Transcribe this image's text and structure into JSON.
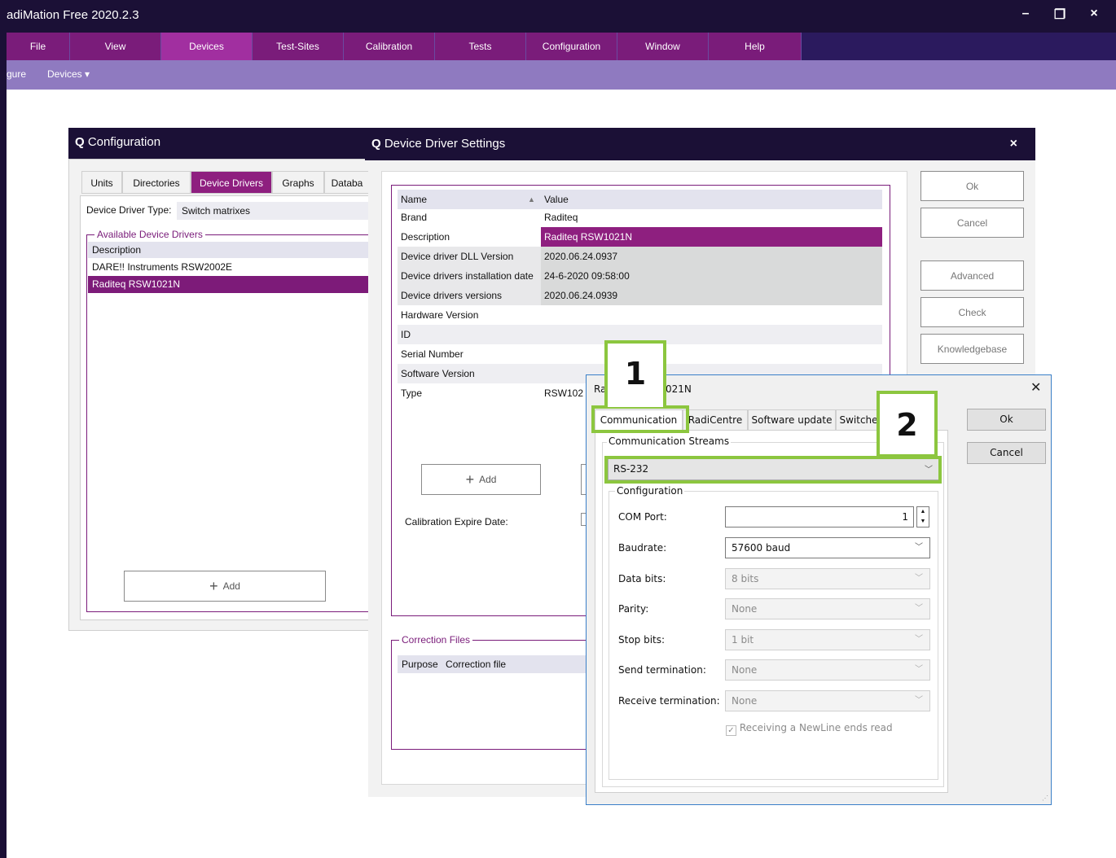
{
  "app": {
    "title": "adiMation Free 2020.2.3",
    "menu": [
      "File",
      "View",
      "Devices",
      "Test-Sites",
      "Calibration",
      "Tests",
      "Configuration",
      "Window",
      "Help"
    ],
    "sub_menu": [
      "gure",
      "Devices ▾"
    ]
  },
  "configuration": {
    "title": "Configuration",
    "tabs": [
      "Units",
      "Directories",
      "Device Drivers",
      "Graphs",
      "Databa"
    ],
    "driver_type_label": "Device Driver Type:",
    "driver_type_value": "Switch matrixes",
    "available_label": "Available Device Drivers",
    "list_header": "Description",
    "drivers": [
      "DARE!! Instruments RSW2002E",
      "Raditeq RSW1021N"
    ],
    "add_label": "Add"
  },
  "device_driver_settings": {
    "title": "Device Driver Settings",
    "close": "×",
    "header_name": "Name",
    "header_value": "Value",
    "rows": [
      {
        "name": "Brand",
        "value": "Raditeq"
      },
      {
        "name": "Description",
        "value": "Raditeq RSW1021N"
      },
      {
        "name": "Device driver DLL Version",
        "value": "2020.06.24.0937"
      },
      {
        "name": "Device drivers installation date",
        "value": "24-6-2020 09:58:00"
      },
      {
        "name": "Device drivers versions",
        "value": "2020.06.24.0939"
      },
      {
        "name": "Hardware Version",
        "value": ""
      },
      {
        "name": "ID",
        "value": ""
      },
      {
        "name": "Serial Number",
        "value": ""
      },
      {
        "name": "Software Version",
        "value": ""
      },
      {
        "name": "Type",
        "value": "RSW102"
      }
    ],
    "add_label": "Add",
    "calibration_label": "Calibration Expire Date:",
    "correction_files_label": "Correction Files",
    "correction_headers": [
      "Purpose",
      "Correction file"
    ],
    "buttons": [
      "Ok",
      "Cancel",
      "Advanced",
      "Check",
      "Knowledgebase"
    ]
  },
  "driver_dialog": {
    "title_left": "Ra",
    "title_right": "021N",
    "close": "✕",
    "tabs": [
      "Communication",
      "RadiCentre",
      "Software update",
      "Switche"
    ],
    "streams_label": "Communication Streams",
    "stream_value": "RS-232",
    "config_label": "Configuration",
    "fields": [
      {
        "label": "COM Port:",
        "value": "1"
      },
      {
        "label": "Baudrate:",
        "value": "57600 baud"
      },
      {
        "label": "Data bits:",
        "value": "8 bits"
      },
      {
        "label": "Parity:",
        "value": "None"
      },
      {
        "label": "Stop bits:",
        "value": "1 bit"
      },
      {
        "label": "Send termination:",
        "value": "None"
      },
      {
        "label": "Receive termination:",
        "value": "None"
      }
    ],
    "newline_checkbox": "Receiving a NewLine ends read",
    "ok": "Ok",
    "cancel": "Cancel"
  },
  "callouts": [
    "1",
    "2"
  ],
  "colors": {
    "accent": "#8cc63f",
    "brand_purple": "#8e1f7f",
    "title_dark": "#1b1036"
  }
}
